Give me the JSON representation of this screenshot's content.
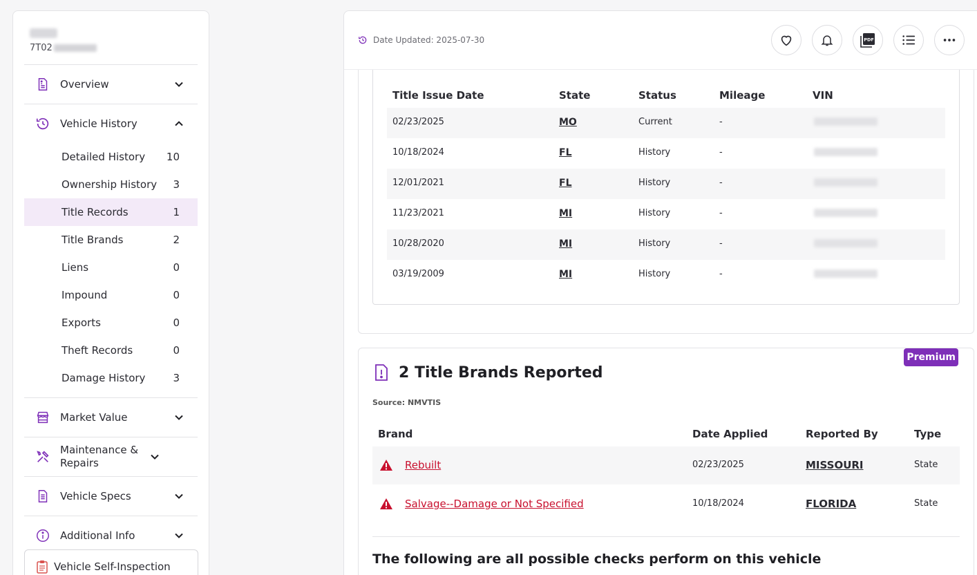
{
  "vehicle": {
    "vin_prefix": "7T02"
  },
  "sidebar": {
    "sections": [
      {
        "label": "Overview",
        "icon": "document-icon",
        "expanded": false
      },
      {
        "label": "Vehicle History",
        "icon": "history-icon",
        "expanded": true
      },
      {
        "label": "Market Value",
        "icon": "store-icon",
        "expanded": false
      },
      {
        "label": "Maintenance & Repairs",
        "icon": "tools-icon",
        "expanded": false
      },
      {
        "label": "Vehicle Specs",
        "icon": "specs-icon",
        "expanded": false
      },
      {
        "label": "Additional Info",
        "icon": "info-icon",
        "expanded": false
      }
    ],
    "history_items": [
      {
        "label": "Detailed History",
        "count": "10"
      },
      {
        "label": "Ownership History",
        "count": "3"
      },
      {
        "label": "Title Records",
        "count": "1"
      },
      {
        "label": "Title Brands",
        "count": "2"
      },
      {
        "label": "Liens",
        "count": "0"
      },
      {
        "label": "Impound",
        "count": "0"
      },
      {
        "label": "Exports",
        "count": "0"
      },
      {
        "label": "Theft Records",
        "count": "0"
      },
      {
        "label": "Damage History",
        "count": "3"
      }
    ],
    "inspection_label": "Vehicle Self-Inspection"
  },
  "header": {
    "updated": "Date Updated: 2025-07-30"
  },
  "title_records": {
    "columns": [
      "Title Issue Date",
      "State",
      "Status",
      "Mileage",
      "VIN"
    ],
    "rows": [
      {
        "date": "02/23/2025",
        "state": "MO",
        "status": "Current",
        "mileage": "-"
      },
      {
        "date": "10/18/2024",
        "state": "FL",
        "status": "History",
        "mileage": "-"
      },
      {
        "date": "12/01/2021",
        "state": "FL",
        "status": "History",
        "mileage": "-"
      },
      {
        "date": "11/23/2021",
        "state": "MI",
        "status": "History",
        "mileage": "-"
      },
      {
        "date": "10/28/2020",
        "state": "MI",
        "status": "History",
        "mileage": "-"
      },
      {
        "date": "03/19/2009",
        "state": "MI",
        "status": "History",
        "mileage": "-"
      }
    ]
  },
  "title_brands": {
    "badge": "Premium",
    "title": "2 Title Brands Reported",
    "source": "Source: NMVTIS",
    "columns": [
      "Brand",
      "Date Applied",
      "Reported By",
      "Type"
    ],
    "rows": [
      {
        "brand": "Rebuilt",
        "date": "02/23/2025",
        "by": "MISSOURI",
        "type": "State"
      },
      {
        "brand": "Salvage--Damage or Not Specified",
        "date": "10/18/2024",
        "by": "FLORIDA",
        "type": "State"
      }
    ],
    "checks_heading": "The following are all possible checks perform on this vehicle"
  },
  "colors": {
    "accent": "#7e2fb8",
    "danger": "#c8102e",
    "active_bg": "#f3eaf8"
  }
}
